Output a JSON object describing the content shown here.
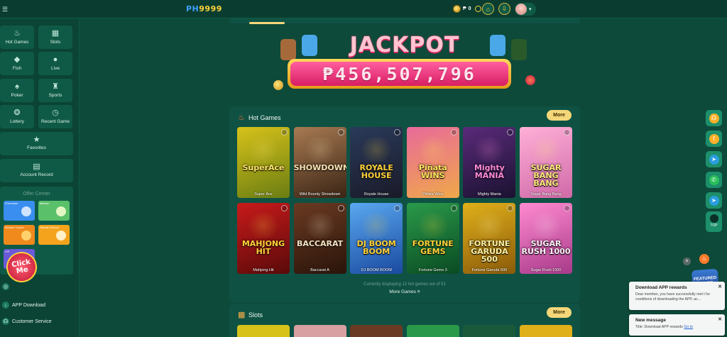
{
  "topbar": {
    "menu_icon": "menu-icon",
    "logo_part1": "PH",
    "logo_part2": "9999",
    "currency": "₱",
    "balance": "0",
    "avatar": "avatar"
  },
  "sidebar": {
    "tiles": [
      {
        "label": "Hot Games",
        "icon": "flame-icon"
      },
      {
        "label": "Slots",
        "icon": "slots-icon"
      },
      {
        "label": "Fish",
        "icon": "fish-icon"
      },
      {
        "label": "Live",
        "icon": "live-icon"
      },
      {
        "label": "Poker",
        "icon": "poker-icon"
      },
      {
        "label": "Sports",
        "icon": "sports-icon"
      },
      {
        "label": "Lottery",
        "icon": "lottery-icon"
      },
      {
        "label": "Recent Game",
        "icon": "recent-icon"
      }
    ],
    "favorites": "Favorites",
    "account_record": "Account Record",
    "offer_center": {
      "title": "Offer Center",
      "cards": [
        {
          "label": "Promotion",
          "color": "#3a8ef0"
        },
        {
          "label": "Mission",
          "color": "#5bc06a"
        },
        {
          "label": "Reward Center",
          "color": "#f08a1c"
        },
        {
          "label": "Rebate Record",
          "color": "#f4a41c"
        },
        {
          "label": "VIP",
          "color": "#6a5ad8"
        }
      ]
    },
    "click_me": "Click Me",
    "app_download": "APP Download",
    "customer_service": "Customer Service"
  },
  "jackpot": {
    "title": "JACKPOT",
    "value": "₱456,507,796"
  },
  "hot_games": {
    "title": "Hot Games",
    "more": "More",
    "status": "Currently displaying 12 hot games out of 51",
    "more_games": "More Games ≡",
    "games": [
      {
        "name": "Super Ace",
        "title": "SuperAce",
        "bg1": "#d7c21a",
        "bg2": "#6a7d12",
        "tc": "#ffe36a"
      },
      {
        "name": "Wild Bounty Showdown",
        "title": "SHOWDOWN",
        "bg1": "#a87a52",
        "bg2": "#3a2414",
        "tc": "#f7e2b3"
      },
      {
        "name": "Royale House",
        "title": "ROYALE HOUSE",
        "bg1": "#2a3a5a",
        "bg2": "#1a1a28",
        "tc": "#ffd23a"
      },
      {
        "name": "Piñata Wins",
        "title": "Piñata WINS",
        "bg1": "#e86a9a",
        "bg2": "#f0a84a",
        "tc": "#ffe65a"
      },
      {
        "name": "Mighty Mania",
        "title": "Mighty MANIA",
        "bg1": "#5a2a7a",
        "bg2": "#1a1230",
        "tc": "#ff8ad8"
      },
      {
        "name": "Sugar Bang Bang",
        "title": "SUGAR BANG BANG",
        "bg1": "#ffb0d8",
        "bg2": "#d06aa8",
        "tc": "#ffea7a"
      },
      {
        "name": "Mahjong Hit",
        "title": "MAHJONG HIT",
        "bg1": "#c81a1a",
        "bg2": "#5a0a0a",
        "tc": "#ffd23a"
      },
      {
        "name": "Baccarat A",
        "title": "BACCARAT",
        "bg1": "#6a3a22",
        "bg2": "#2a140a",
        "tc": "#f3e3c3"
      },
      {
        "name": "DJ BOOM BOOM",
        "title": "DJ BOOM BOOM",
        "bg1": "#5aa8f0",
        "bg2": "#1a4aa0",
        "tc": "#ffd23a"
      },
      {
        "name": "Fortune Gems 3",
        "title": "FORTUNE GEMS",
        "bg1": "#2a9a4a",
        "bg2": "#0a4a22",
        "tc": "#ffd23a"
      },
      {
        "name": "Fortune Garuda 500",
        "title": "FORTUNE GARUDA 500",
        "bg1": "#e0b01a",
        "bg2": "#8a5a0a",
        "tc": "#fff1a0"
      },
      {
        "name": "Sugar Rush 1000",
        "title": "SUGAR RUSH 1000",
        "bg1": "#ff8ad0",
        "bg2": "#a83a8a",
        "tc": "#fff0fa"
      }
    ]
  },
  "slots": {
    "title": "Slots",
    "more": "More"
  },
  "right_bar": {
    "icons": [
      "headset-icon",
      "facebook-icon",
      "telegram-icon",
      "whatsapp-icon",
      "telegram-icon"
    ],
    "top_label": "TOP"
  },
  "featured": "FEATURED GAMES",
  "toasts": [
    {
      "title": "Download APP rewards",
      "body": "Dear member, you have successfully met t he conditions of downloading the APP, ac...",
      "link": ""
    },
    {
      "title": "New message",
      "body": "Title: Download APP rewards",
      "link": "Go to"
    }
  ],
  "colors": {
    "accent": "#f5d77a",
    "bg": "#0d4a3a",
    "panel": "#0f5244"
  }
}
